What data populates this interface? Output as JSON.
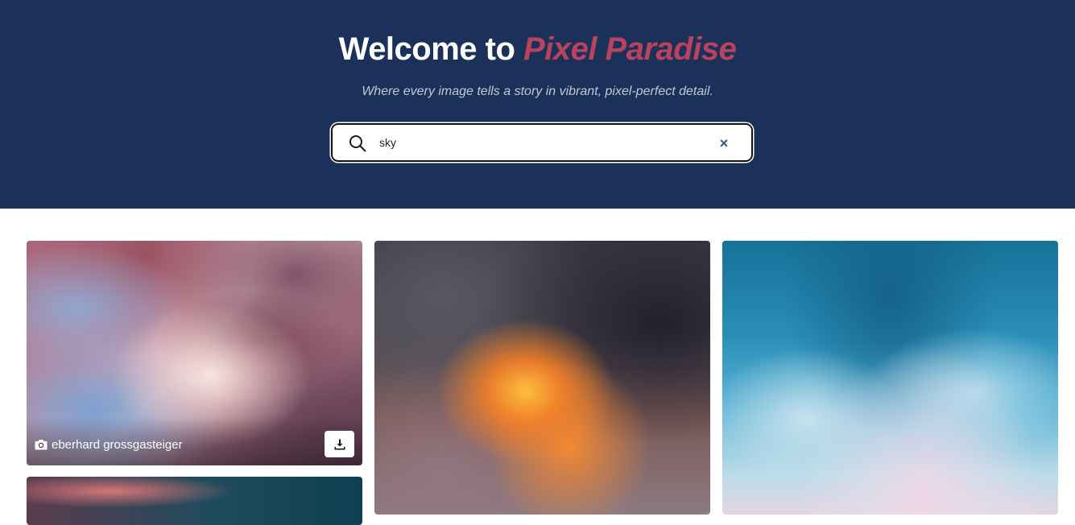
{
  "header": {
    "title_prefix": "Welcome to ",
    "title_brand": "Pixel Paradise",
    "subtitle": "Where every image tells a story in vibrant, pixel-perfect detail."
  },
  "search": {
    "value": "sky",
    "icon": "search-icon",
    "clear_label": "×"
  },
  "gallery": {
    "cards": [
      {
        "photographer": "eberhard grossgasteiger",
        "icon": "camera-icon",
        "download_icon": "download-icon"
      }
    ]
  },
  "colors": {
    "hero_background": "#1c3159",
    "brand_accent": "#b9435f",
    "clear_icon": "#2e5b8e"
  }
}
